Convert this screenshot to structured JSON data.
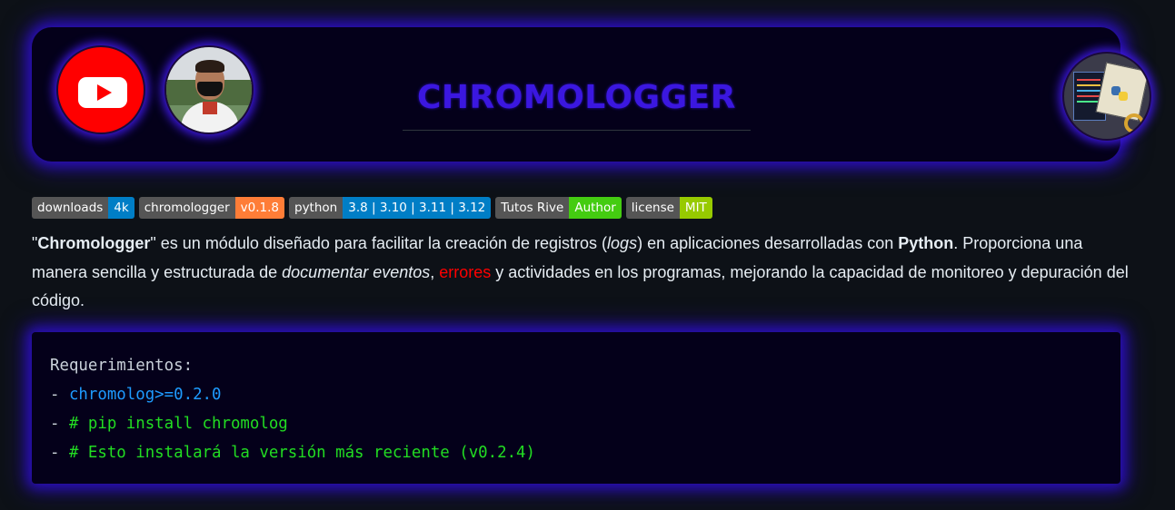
{
  "header": {
    "title": "CHROMOLOGGER",
    "avatars": [
      "youtube-icon",
      "profile-photo",
      "chromologger-logo"
    ],
    "brand_color": "#3b17e0",
    "glow_color": "#2a0fb8"
  },
  "badges": [
    {
      "label": "downloads",
      "value": "4k",
      "color": "#007ec6"
    },
    {
      "label": "chromologger",
      "value": "v0.1.8",
      "color": "#fe7d37"
    },
    {
      "label": "python",
      "value": "3.8 | 3.10 | 3.11 | 3.12",
      "color": "#007ec6"
    },
    {
      "label": "Tutos Rive",
      "value": "Author",
      "color": "#4c1"
    },
    {
      "label": "license",
      "value": "MIT",
      "color": "#97ca00"
    }
  ],
  "description": {
    "q_open": "\"",
    "name": "Chromologger",
    "q_close": "\"",
    "p1": " es un módulo diseñado para facilitar la creación de registros (",
    "logs": "logs",
    "p2": ") en aplicaciones desarrolladas con ",
    "python": "Python",
    "p3": ". Proporciona una manera sencilla y estructurada de ",
    "documentar": "documentar eventos",
    "p4": ", ",
    "errores": "errores",
    "p5": " y actividades en los programas, mejorando la capacidad de monitoreo y depuración del código."
  },
  "code": {
    "heading": "Requerimientos:",
    "dash": "- ",
    "line1": "chromolog>=0.2.0",
    "line2": "# pip install chromolog",
    "line3": "# Esto instalará la versión más reciente (v0.2.4)"
  }
}
